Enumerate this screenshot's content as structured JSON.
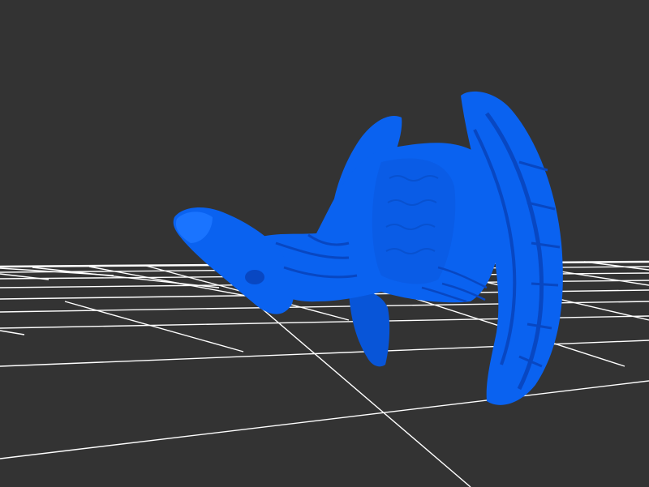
{
  "viewer": {
    "background_color": "#333333",
    "grid_color": "#ffffff",
    "model_color": "#0a62f0",
    "model_shade_color": "#0847c2",
    "model_highlight_color": "#2a86ff",
    "model_subject": "dragon-bust"
  }
}
